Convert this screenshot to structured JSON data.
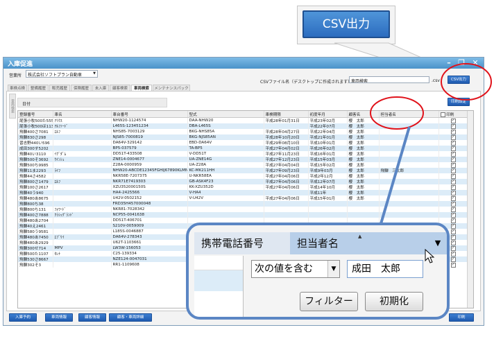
{
  "csv_callout": {
    "label": "CSV出力"
  },
  "window": {
    "title": "入庫促進",
    "controls": {
      "minimize": "–",
      "restore": "❐",
      "close": "✕"
    }
  },
  "header": {
    "office_label": "営業所",
    "office_value": "株式会社ソフトプラン自動車",
    "csv_name_label": "CSVファイル名（デスクトップに作成されます）",
    "csv_name_value": "車両検索",
    "csv_ext": ".csv",
    "csv_button": "CSV出力"
  },
  "tabs": [
    "車検点検",
    "整備履歴",
    "販売履歴",
    "保険履歴",
    "未入庫",
    "顧客検索",
    "車両検索",
    "メンテナンスパック"
  ],
  "side_tab": "車両検索",
  "date_label": "日付",
  "print_settings_button": "印刷設定",
  "table": {
    "columns": [
      "登録番号",
      "車名",
      "車台番号",
      "型式",
      "車検期限",
      "初度年月",
      "顧客名",
      "担当者名",
      "印刷"
    ],
    "rows": [
      [
        "尾張小牧500た5557",
        "ｱﾘｸｽ",
        "NHW20-1124574",
        "DAA-NHW20",
        "平成28年01月31日",
        "平成23年02月",
        "櫻　太郎",
        "",
        true
      ],
      [
        "尾張小牧500ほ1134",
        "ｱﾙﾌｧｰﾄﾞ",
        "L465S-123451234",
        "DBA-L465S",
        "",
        "平成22年07月",
        "櫻　太郎",
        "",
        true
      ],
      [
        "飛騨400さ7081",
        "ｴﾙﾌ",
        "NHS85-7003129",
        "BKG-NHS85A",
        "平成28年04月27日",
        "平成22年04月",
        "櫻　太郎",
        "",
        true
      ],
      [
        "飛騨830さ298",
        "",
        "NJS85-7000819",
        "BKG-NJS85AN",
        "平成28年10月20日",
        "平成21年01月",
        "櫻　太郎",
        "",
        true
      ],
      [
        "習志野440い596",
        "",
        "DA64V-329142",
        "EBD-DA64V",
        "平成29年08月10日",
        "平成10年01月",
        "櫻　太郎",
        "",
        true
      ],
      [
        "成田300す5202",
        "",
        "BP5-037579",
        "TA-BP5",
        "平成27年04月02日",
        "平成26年02月",
        "櫻　太郎",
        "",
        true
      ],
      [
        "飛騨40い3110",
        "ｲｸﾞﾀﾞﾑ",
        "DD51T-433508",
        "V-DD51T",
        "平成27年11月23日",
        "平成16年01月",
        "櫻　太郎",
        "",
        true
      ],
      [
        "飛騨500そ3692",
        "ｳｲﾝｼｭ",
        "ZNE14-0004677",
        "UA-ZNE14G",
        "平成27年12月23日",
        "平成15年03月",
        "櫻　太郎",
        "",
        true
      ],
      [
        "飛騨500ち9985",
        "",
        "Z28A-0000959",
        "UA-Z28A",
        "平成27年04月04日",
        "平成15年02月",
        "櫻　太郎",
        "",
        true
      ],
      [
        "飛騨11ま2293",
        "ﾗｲﾌ",
        "NHW20-ABCDE12345FGHIJ67890KLMN",
        "KC-MK211HH",
        "平成27年09月23日",
        "平成9年03月",
        "櫻　太郎",
        "飛騨　三太郎",
        true
      ],
      [
        "飛騨44さ4582",
        "",
        "NKR58E-7207375",
        "U-NKR58EA",
        "平成27年04月06日",
        "平成2年12月",
        "櫻　太郎",
        "",
        true
      ],
      [
        "飛騨800さ1479",
        "ｴﾙﾌ",
        "NKR71E7419303",
        "GB-ASK4F23",
        "平成27年04月06日",
        "平成12年07月",
        "櫻　太郎",
        "",
        true
      ],
      [
        "飛騨100さ2617",
        "",
        "XZU352000150S",
        "KK-XZU352D",
        "平成27年04月06日",
        "平成14年10月",
        "櫻　太郎",
        "",
        true
      ],
      [
        "飛騨40う940",
        "",
        "HA4-2425566",
        "V-HA4",
        "",
        "平成11年",
        "櫻　太郎",
        "",
        true
      ],
      [
        "飛騨480あ8675",
        "",
        "U42V-0502152",
        "V-U42V",
        "平成27年04月06日",
        "平成15年01月",
        "櫻　太郎",
        "",
        true
      ],
      [
        "飛騨800ち38",
        "",
        "FRD35H457000048",
        "",
        "",
        "",
        "",
        "",
        true
      ],
      [
        "飛騨800ち131",
        "ﾌｫﾜｰﾄﾞ",
        "NKR81-7028342",
        "",
        "",
        "",
        "",
        "",
        true
      ],
      [
        "飛騨400さ7888",
        "ｸﾗｼｯｸﾞﾗﾝﾄﾞ",
        "NCP55-0041638",
        "",
        "",
        "",
        "",
        "",
        true
      ],
      [
        "飛騨480あ2704",
        "",
        "DD51T-406701",
        "",
        "",
        "",
        "",
        "",
        true
      ],
      [
        "飛騨40え2461",
        "",
        "S210V-0059009",
        "",
        "",
        "",
        "",
        "",
        true
      ],
      [
        "飛騨580う9581",
        "",
        "L185S-0046887",
        "",
        "",
        "",
        "",
        "",
        true
      ],
      [
        "飛騨480あ7450",
        "ｴﾌﾞﾘｲ",
        "DA64V-278343",
        "",
        "",
        "",
        "",
        "",
        true
      ],
      [
        "飛騨480あ2929",
        "",
        "U62T-1103661",
        "",
        "",
        "",
        "",
        "",
        true
      ],
      [
        "飛騨300せ714",
        "MPV",
        "LW3W-156053",
        "",
        "",
        "",
        "",
        "",
        true
      ],
      [
        "飛騨500た1107",
        "ｾﾚﾅ",
        "C25-139334",
        "",
        "",
        "",
        "",
        "",
        true
      ],
      [
        "飛騨530さ8667",
        "",
        "NZE124-0047031",
        "",
        "",
        "",
        "",
        "",
        true
      ],
      [
        "飛騨302そ3",
        "",
        "RR1-1109608",
        "",
        "",
        "",
        "",
        "",
        true
      ]
    ]
  },
  "bottom_buttons": [
    "入庫予約",
    "車両情報",
    "顧客情報",
    "顧客・車両詳細"
  ],
  "print_button": "印刷",
  "zoom": {
    "col_mobile": "携帯電話番号",
    "col_staff": "担当者名",
    "condition": "次の値を含む",
    "value": "成田　太郎",
    "filter_button": "フィルター",
    "reset_button": "初期化",
    "sort_glyph": "▲",
    "dropdown_glyph": "▼"
  },
  "colors": {
    "accent": "#2c6cbf",
    "highlight_circle": "#e0121a",
    "row_alt": "#dcecf8",
    "title_bar": "#4a92c9"
  }
}
